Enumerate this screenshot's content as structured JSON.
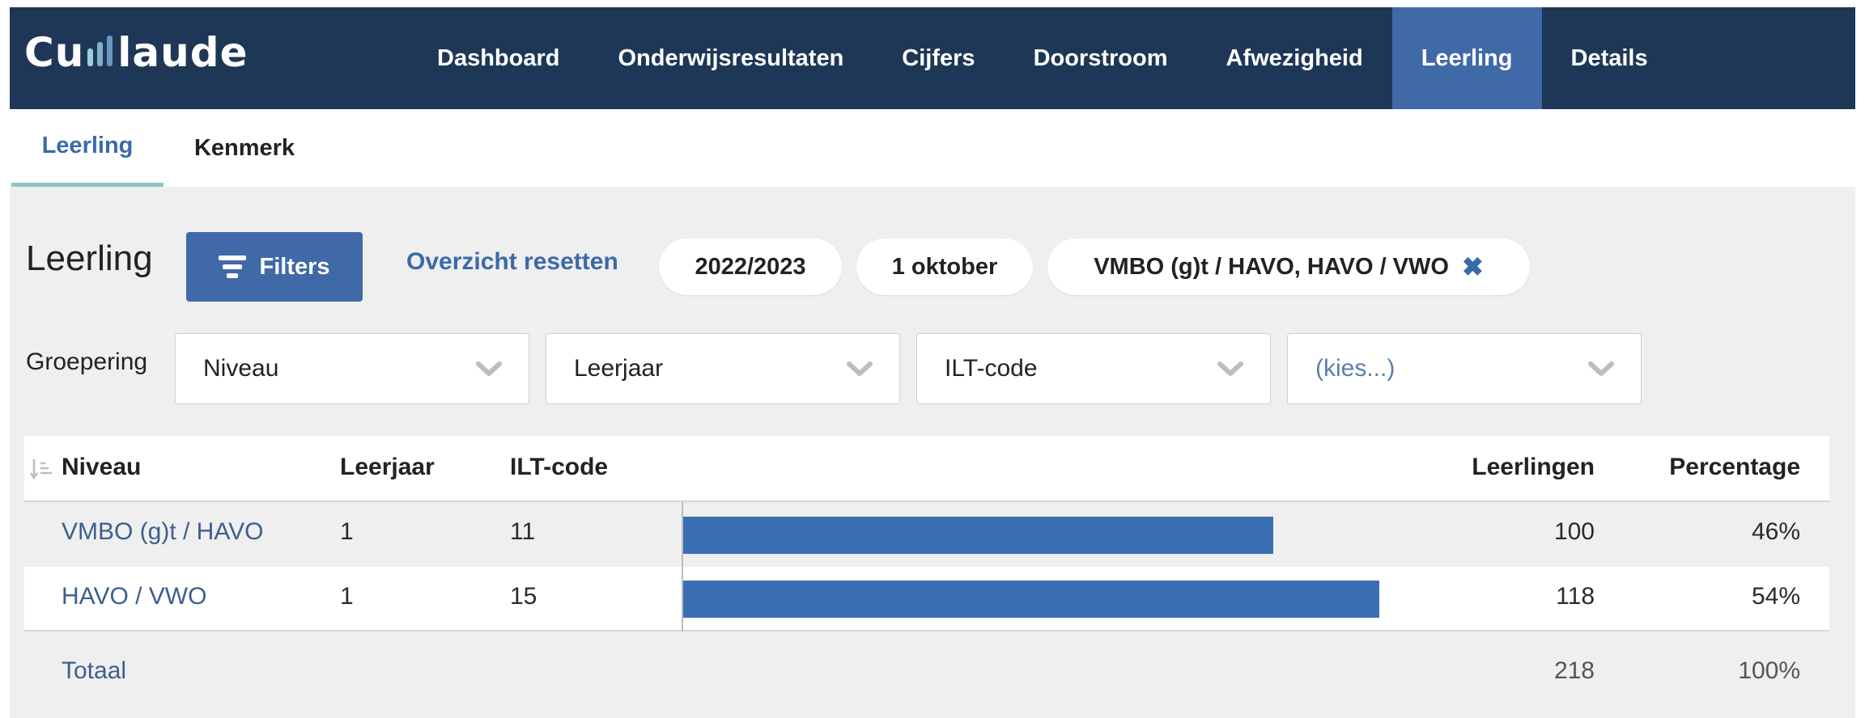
{
  "app": {
    "logo_text_a": "Cu",
    "logo_text_b": "laude"
  },
  "colors": {
    "nav_bg": "#1f3756",
    "accent": "#4069a8",
    "bar": "#3a6fb3",
    "link": "#3b6aa9",
    "tab_underline": "#8cc4c8",
    "logo_bars": [
      "#9ad1d4",
      "#7fb3c7",
      "#6a97bd",
      "#5a7fae"
    ]
  },
  "nav": {
    "items": [
      {
        "label": "Dashboard",
        "active": false
      },
      {
        "label": "Onderwijsresultaten",
        "active": false
      },
      {
        "label": "Cijfers",
        "active": false
      },
      {
        "label": "Doorstroom",
        "active": false
      },
      {
        "label": "Afwezigheid",
        "active": false
      },
      {
        "label": "Leerling",
        "active": true
      },
      {
        "label": "Details",
        "active": false
      }
    ]
  },
  "subtabs": [
    {
      "label": "Leerling",
      "active": true
    },
    {
      "label": "Kenmerk",
      "active": false
    }
  ],
  "toolbar": {
    "title": "Leerling",
    "filters_label": "Filters",
    "reset_label": "Overzicht resetten",
    "pills": [
      "2022/2023",
      "1 oktober",
      "VMBO (g)t / HAVO, HAVO / VWO"
    ],
    "pill_close_icon": "close-icon"
  },
  "grouping": {
    "label": "Groepering",
    "selects": [
      "Niveau",
      "Leerjaar",
      "ILT-code",
      "(kies...)"
    ]
  },
  "table": {
    "headers": {
      "niveau": "Niveau",
      "leerjaar": "Leerjaar",
      "iltcode": "ILT-code",
      "leerlingen": "Leerlingen",
      "percentage": "Percentage"
    },
    "rows": [
      {
        "niveau": "VMBO (g)t / HAVO",
        "leerjaar": "1",
        "iltcode": "11",
        "leerlingen": "100",
        "percentage": "46%",
        "bar_value": 100
      },
      {
        "niveau": "HAVO / VWO",
        "leerjaar": "1",
        "iltcode": "15",
        "leerlingen": "118",
        "percentage": "54%",
        "bar_value": 118
      }
    ],
    "total": {
      "label": "Totaal",
      "leerlingen": "218",
      "percentage": "100%"
    },
    "bar_scale_max": 140
  }
}
